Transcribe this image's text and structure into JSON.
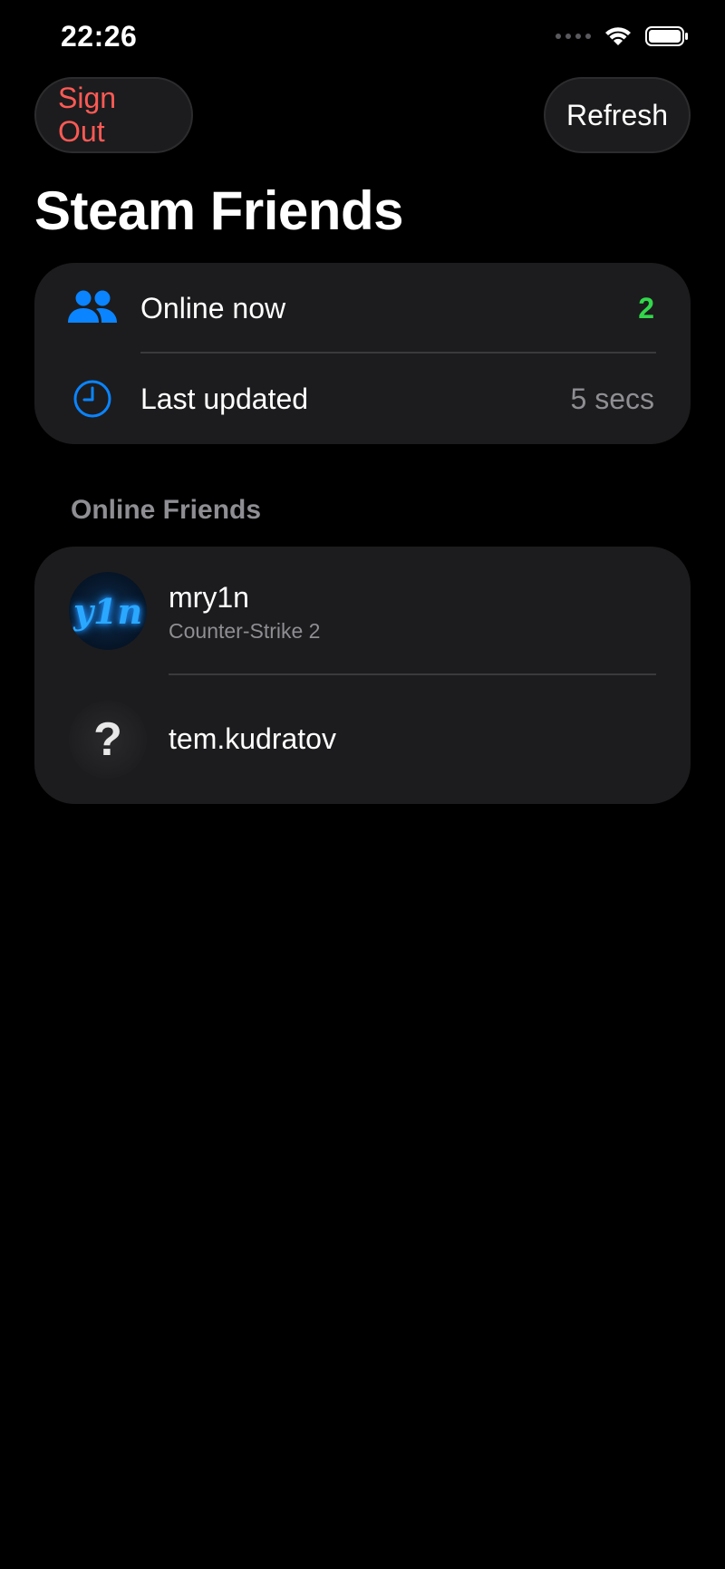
{
  "status_bar": {
    "time": "22:26"
  },
  "toolbar": {
    "sign_out_label": "Sign Out",
    "refresh_label": "Refresh"
  },
  "page": {
    "title": "Steam Friends"
  },
  "summary": {
    "online_label": "Online now",
    "online_count": "2",
    "updated_label": "Last updated",
    "updated_value": "5 secs"
  },
  "friends_section": {
    "header": "Online Friends",
    "friends": [
      {
        "name": "mry1n",
        "status": "Counter-Strike 2",
        "avatar_text": "y1n"
      },
      {
        "name": "tem.kudratov",
        "status": "",
        "avatar_text": "?"
      }
    ]
  },
  "colors": {
    "accent_blue": "#0a84ff",
    "online_green": "#32d74b",
    "sign_out_red": "#ff5a55",
    "card_bg": "#1c1c1e"
  },
  "icons": {
    "online": "people-icon",
    "updated": "clock-icon"
  }
}
